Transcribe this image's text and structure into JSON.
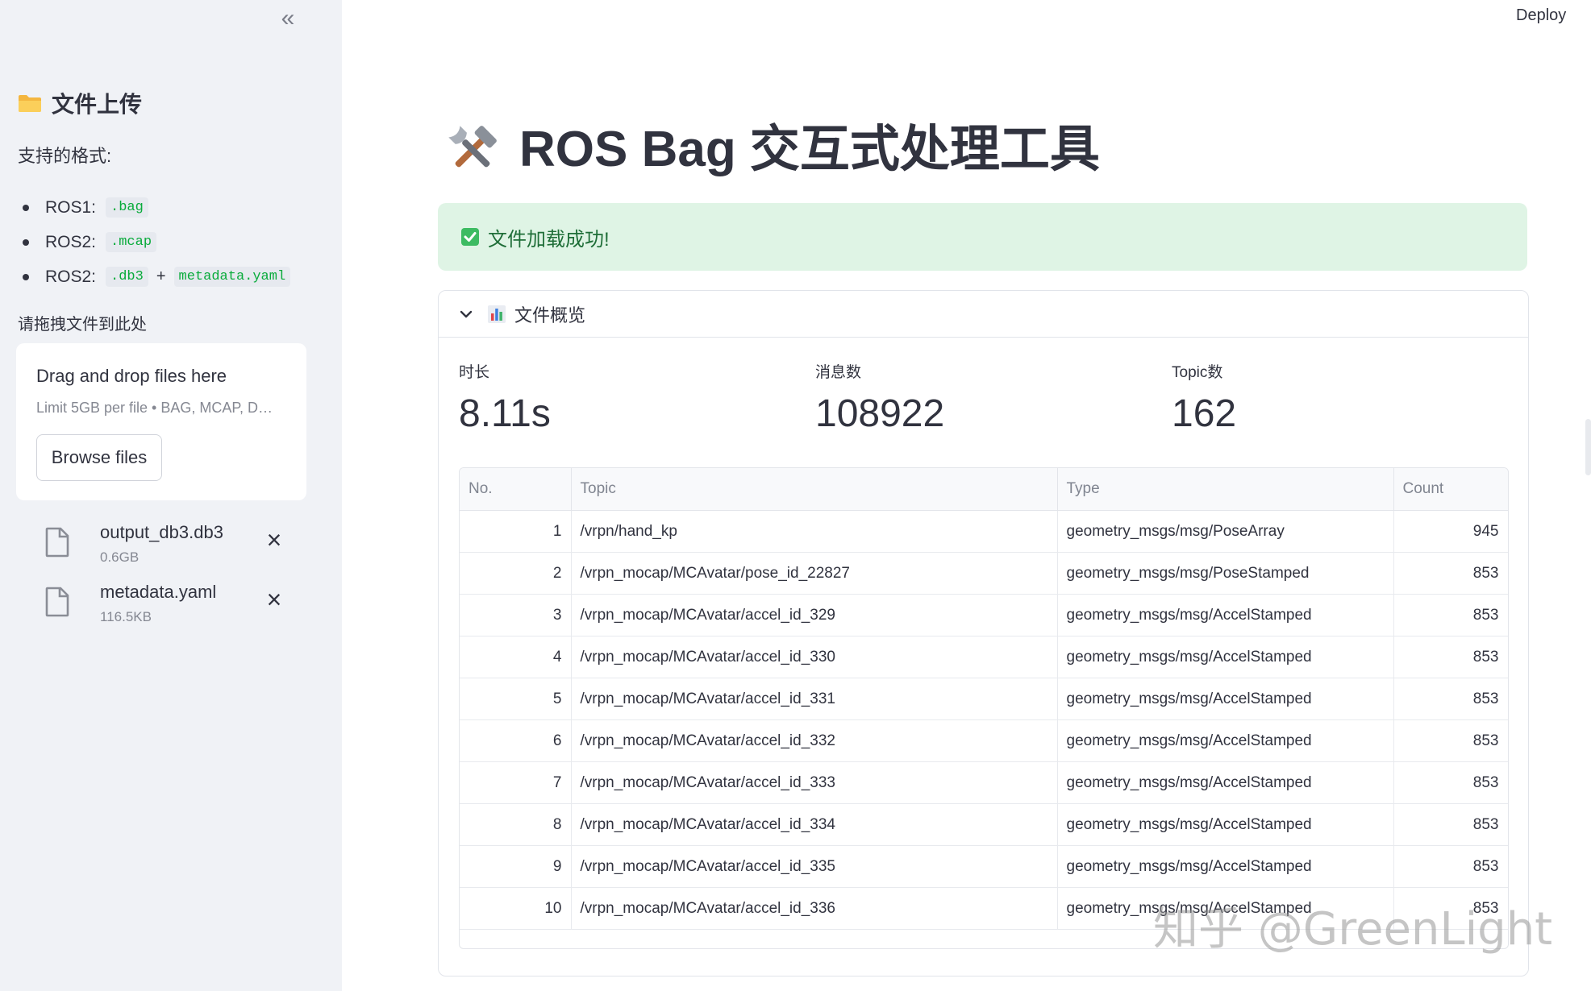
{
  "sidebar": {
    "collapse_icon": "double-chevron-left-icon",
    "title": "文件上传",
    "title_icon": "folder-icon",
    "formats_heading": "支持的格式:",
    "formats": [
      {
        "label": "ROS1:",
        "codes": [
          ".bag"
        ]
      },
      {
        "label": "ROS2:",
        "codes": [
          ".mcap"
        ]
      },
      {
        "label": "ROS2:",
        "codes": [
          ".db3",
          "metadata.yaml"
        ],
        "joiner": "+"
      }
    ],
    "drop_label": "请拖拽文件到此处",
    "dropzone": {
      "title": "Drag and drop files here",
      "limit": "Limit 5GB per file • BAG, MCAP, D…",
      "browse_label": "Browse files"
    },
    "files": [
      {
        "name": "output_db3.db3",
        "size": "0.6GB"
      },
      {
        "name": "metadata.yaml",
        "size": "116.5KB"
      }
    ]
  },
  "header": {
    "deploy_label": "Deploy"
  },
  "main": {
    "title": "ROS Bag 交互式处理工具",
    "title_icon": "tools-icon",
    "success_message": "文件加载成功!",
    "expander_title": "文件概览",
    "metrics": [
      {
        "label": "时长",
        "value": "8.11s"
      },
      {
        "label": "消息数",
        "value": "108922"
      },
      {
        "label": "Topic数",
        "value": "162"
      }
    ],
    "table": {
      "columns": [
        "No.",
        "Topic",
        "Type",
        "Count"
      ],
      "rows": [
        [
          "1",
          "/vrpn/hand_kp",
          "geometry_msgs/msg/PoseArray",
          "945"
        ],
        [
          "2",
          "/vrpn_mocap/MCAvatar/pose_id_22827",
          "geometry_msgs/msg/PoseStamped",
          "853"
        ],
        [
          "3",
          "/vrpn_mocap/MCAvatar/accel_id_329",
          "geometry_msgs/msg/AccelStamped",
          "853"
        ],
        [
          "4",
          "/vrpn_mocap/MCAvatar/accel_id_330",
          "geometry_msgs/msg/AccelStamped",
          "853"
        ],
        [
          "5",
          "/vrpn_mocap/MCAvatar/accel_id_331",
          "geometry_msgs/msg/AccelStamped",
          "853"
        ],
        [
          "6",
          "/vrpn_mocap/MCAvatar/accel_id_332",
          "geometry_msgs/msg/AccelStamped",
          "853"
        ],
        [
          "7",
          "/vrpn_mocap/MCAvatar/accel_id_333",
          "geometry_msgs/msg/AccelStamped",
          "853"
        ],
        [
          "8",
          "/vrpn_mocap/MCAvatar/accel_id_334",
          "geometry_msgs/msg/AccelStamped",
          "853"
        ],
        [
          "9",
          "/vrpn_mocap/MCAvatar/accel_id_335",
          "geometry_msgs/msg/AccelStamped",
          "853"
        ],
        [
          "10",
          "/vrpn_mocap/MCAvatar/accel_id_336",
          "geometry_msgs/msg/AccelStamped",
          "853"
        ]
      ]
    }
  },
  "watermark": "知乎 @GreenLight",
  "colors": {
    "sidebar_bg": "#f0f2f6",
    "success_bg": "#dff4e5",
    "success_text": "#1f6e38",
    "code_text": "#09ab3b",
    "text": "#31333f"
  }
}
